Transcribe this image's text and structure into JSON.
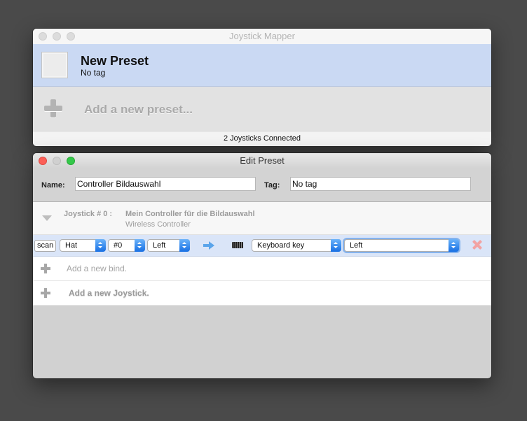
{
  "mapper_window": {
    "title": "Joystick Mapper",
    "selected_preset": {
      "name": "New Preset",
      "tag": "No tag"
    },
    "add_preset_label": "Add a new preset...",
    "status": "2 Joysticks Connected"
  },
  "edit_window": {
    "title": "Edit Preset",
    "name_label": "Name:",
    "name_value": "Controller Bildauswahl",
    "tag_label": "Tag:",
    "tag_value": "No tag",
    "joystick": {
      "id_label": "Joystick # 0 :",
      "name": "Mein Controller für die Bildauswahl",
      "subtitle": "Wireless Controller"
    },
    "bind": {
      "scan_label": "scan",
      "type": "Hat",
      "index": "#0",
      "direction": "Left",
      "action_type": "Keyboard key",
      "action_value": "Left"
    },
    "add_bind_label": "Add a new bind.",
    "add_joystick_label": "Add a new Joystick."
  },
  "colors": {
    "selection": "#cad9f3",
    "bind_row": "#dae5f8",
    "accent_blue": "#176fe3",
    "close_red": "#fc5f57",
    "zoom_green": "#34c84a"
  }
}
